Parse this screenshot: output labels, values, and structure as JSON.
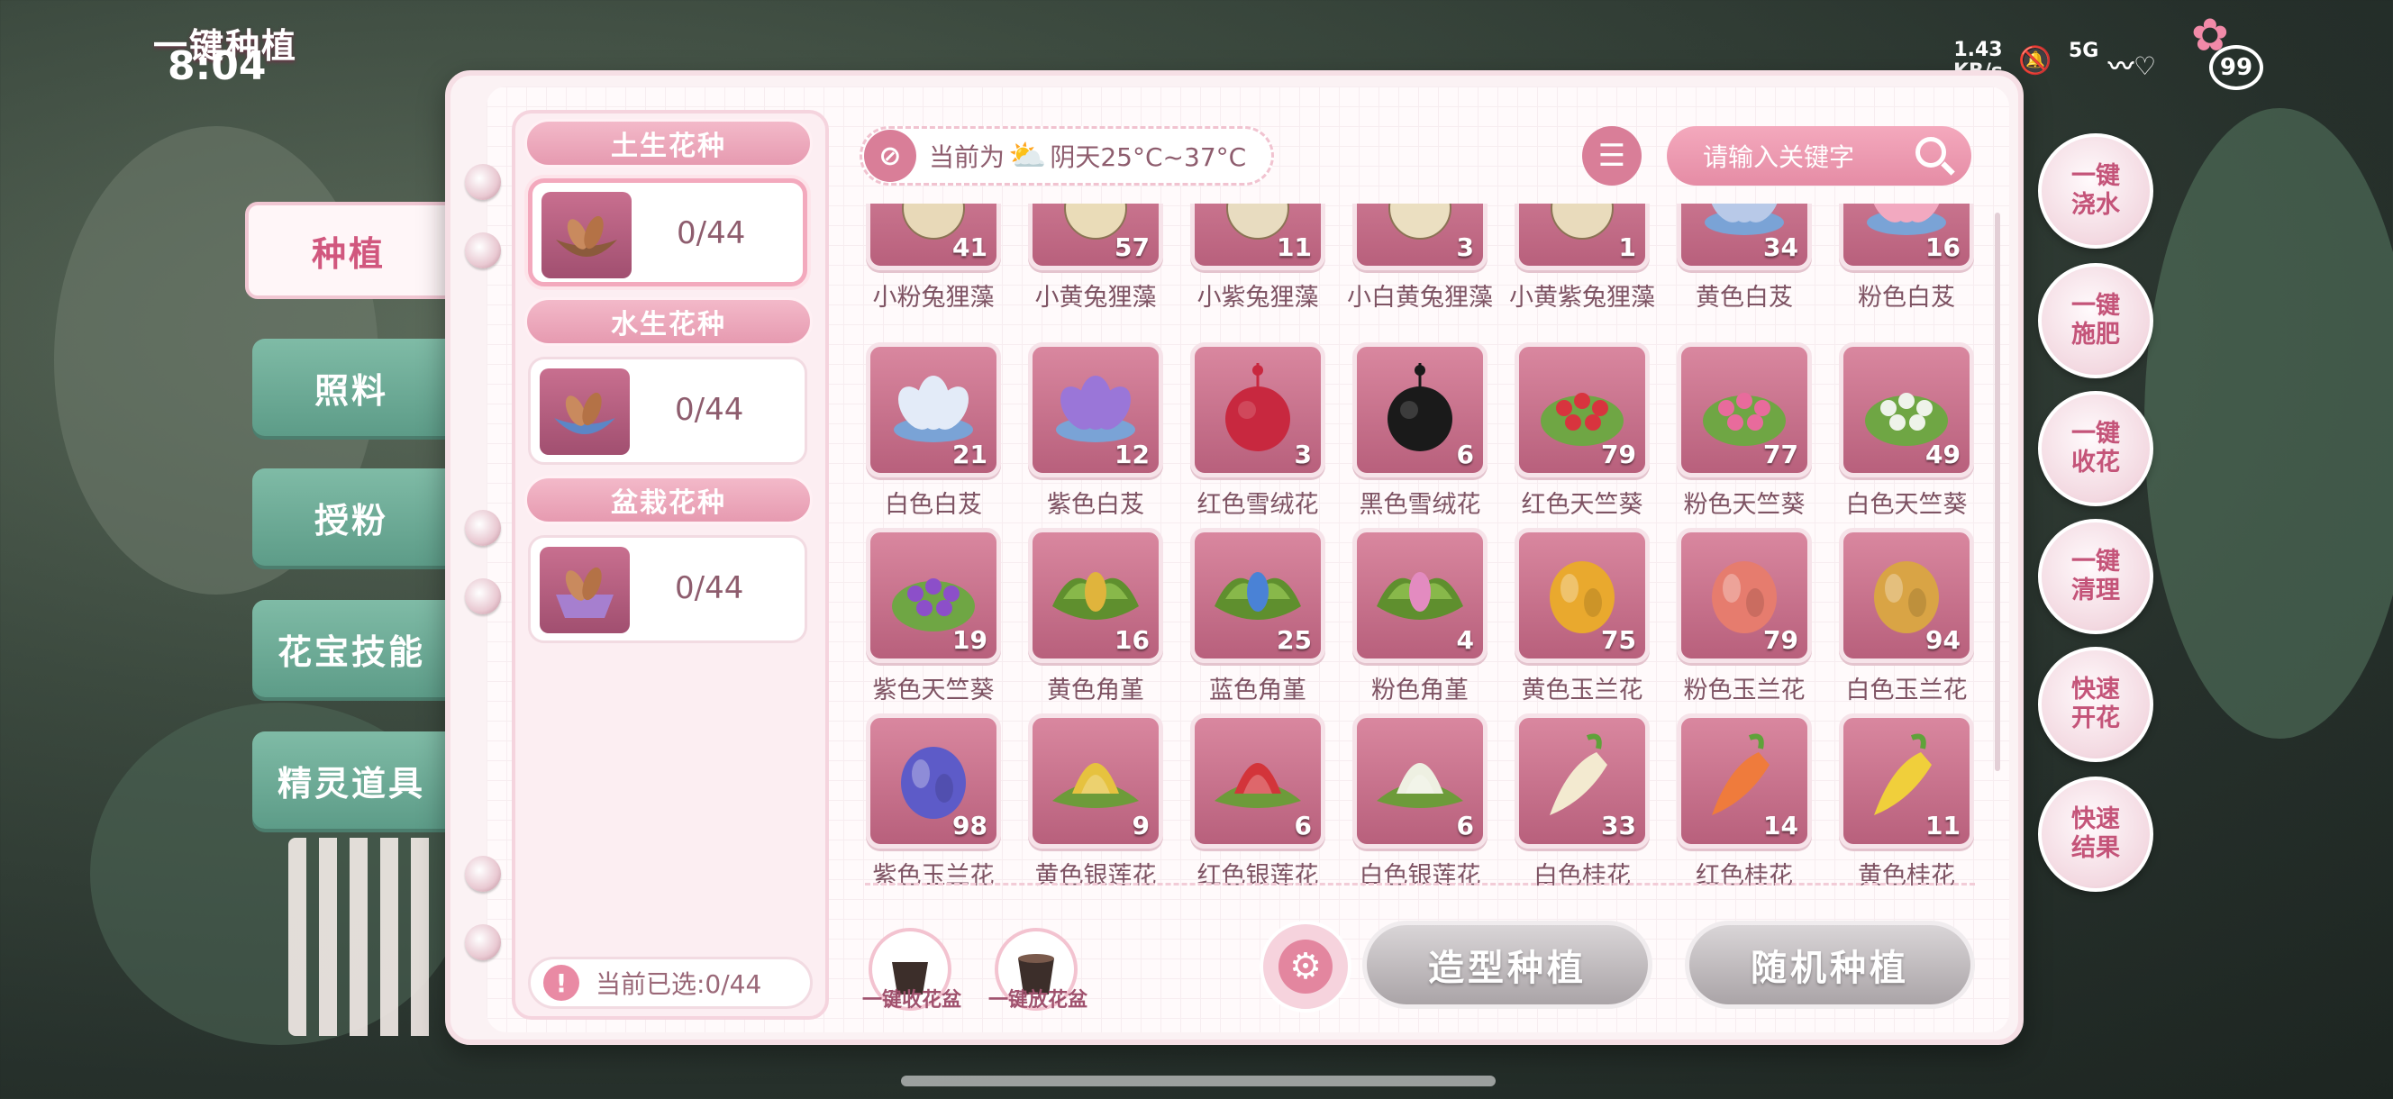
{
  "header": {
    "title": "一键种植",
    "clock": "8:04"
  },
  "status_bar": {
    "speed": "1.43",
    "speed_unit": "KB/s",
    "network": "5G",
    "battery": "99"
  },
  "left_tabs": [
    {
      "label": "种植",
      "active": true
    },
    {
      "label": "照料",
      "active": false
    },
    {
      "label": "授粉",
      "active": false
    },
    {
      "label": "花宝技能",
      "active": false
    },
    {
      "label": "精灵道具",
      "active": false
    }
  ],
  "seed_panel": {
    "groups": [
      {
        "title": "土生花种",
        "count": "0/44",
        "selected": true
      },
      {
        "title": "水生花种",
        "count": "0/44",
        "selected": false
      },
      {
        "title": "盆栽花种",
        "count": "0/44",
        "selected": false
      }
    ],
    "selected_text": "当前已选:0/44",
    "warn_icon": "!"
  },
  "toolbar": {
    "weather_prefix": "当前为",
    "weather_text": "阴天25°C~37°C",
    "search_placeholder": "请输入关键字"
  },
  "flowers": [
    {
      "name": "小粉兔狸藻",
      "count": "41",
      "type": "bulb",
      "color": "#e8d9b8"
    },
    {
      "name": "小黄兔狸藻",
      "count": "57",
      "type": "bulb",
      "color": "#eadcb8"
    },
    {
      "name": "小紫兔狸藻",
      "count": "11",
      "type": "bulb",
      "color": "#e8dcc0"
    },
    {
      "name": "小白黄兔狸藻",
      "count": "3",
      "type": "bulb",
      "color": "#ebdfc1"
    },
    {
      "name": "小黄紫兔狸藻",
      "count": "1",
      "type": "bulb",
      "color": "#e9dbbc"
    },
    {
      "name": "黄色白芨",
      "count": "34",
      "type": "lotus",
      "color": "#b8c9e8"
    },
    {
      "name": "粉色白芨",
      "count": "16",
      "type": "lotus",
      "color": "#f2a9c0"
    },
    {
      "name": "白色白芨",
      "count": "21",
      "type": "lotus",
      "color": "#e3ebf8"
    },
    {
      "name": "紫色白芨",
      "count": "12",
      "type": "lotus",
      "color": "#9a76d8"
    },
    {
      "name": "红色雪绒花",
      "count": "3",
      "type": "pom",
      "color": "#c8283f"
    },
    {
      "name": "黑色雪绒花",
      "count": "6",
      "type": "pom",
      "color": "#1a1a1a"
    },
    {
      "name": "红色天竺葵",
      "count": "79",
      "type": "geranium",
      "color": "#d8343e"
    },
    {
      "name": "粉色天竺葵",
      "count": "77",
      "type": "geranium",
      "color": "#e86b9c"
    },
    {
      "name": "白色天竺葵",
      "count": "49",
      "type": "geranium",
      "color": "#eef3ea"
    },
    {
      "name": "紫色天竺葵",
      "count": "19",
      "type": "geranium",
      "color": "#8c4fc9"
    },
    {
      "name": "黄色角堇",
      "count": "16",
      "type": "pansy",
      "color": "#e0b43c"
    },
    {
      "name": "蓝色角堇",
      "count": "25",
      "type": "pansy",
      "color": "#4a82d6"
    },
    {
      "name": "粉色角堇",
      "count": "4",
      "type": "pansy",
      "color": "#e38bc0"
    },
    {
      "name": "黄色玉兰花",
      "count": "75",
      "type": "magnolia",
      "color": "#e9a92e"
    },
    {
      "name": "粉色玉兰花",
      "count": "79",
      "type": "magnolia",
      "color": "#e67c6e"
    },
    {
      "name": "白色玉兰花",
      "count": "94",
      "type": "magnolia",
      "color": "#d9a445"
    },
    {
      "name": "紫色玉兰花",
      "count": "98",
      "type": "magnolia",
      "color": "#5d5bc8"
    },
    {
      "name": "黄色银莲花",
      "count": "9",
      "type": "anemone",
      "color": "#e6c23f"
    },
    {
      "name": "红色银莲花",
      "count": "6",
      "type": "anemone",
      "color": "#d3343a"
    },
    {
      "name": "白色银莲花",
      "count": "6",
      "type": "anemone",
      "color": "#eef0e2"
    },
    {
      "name": "白色桂花",
      "count": "33",
      "type": "carrot",
      "color": "#f3ead0"
    },
    {
      "name": "红色桂花",
      "count": "14",
      "type": "carrot",
      "color": "#ef7b3c"
    },
    {
      "name": "黄色桂花",
      "count": "11",
      "type": "carrot",
      "color": "#f0cf3b"
    }
  ],
  "bottom": {
    "harvest_pot_label": "一键收花盆",
    "place_pot_label": "一键放花盆",
    "shape_plant_label": "造型种植",
    "random_plant_label": "随机种植"
  },
  "right_actions": [
    {
      "label": "一键浇水"
    },
    {
      "label": "一键施肥"
    },
    {
      "label": "一键收花"
    },
    {
      "label": "一键清理"
    },
    {
      "label": "快速开花"
    },
    {
      "label": "快速结果"
    }
  ]
}
